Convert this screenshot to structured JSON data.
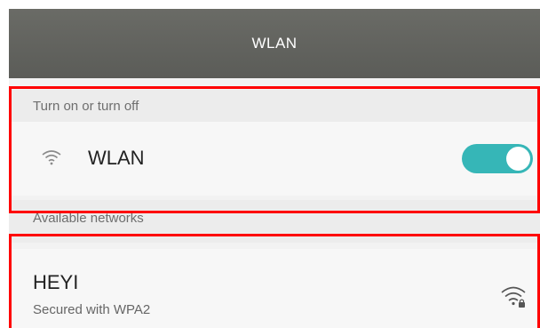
{
  "header": {
    "title": "WLAN"
  },
  "toggle_section": {
    "header": "Turn on or turn off"
  },
  "wlan_row": {
    "label": "WLAN",
    "enabled": true
  },
  "networks_section": {
    "header": "Available networks"
  },
  "networks": [
    {
      "name": "HEYI",
      "security": "Secured with WPA2",
      "icon": "wifi-lock-icon"
    }
  ],
  "colors": {
    "titlebar": "#5f605c",
    "toggle_on": "#36b6b7",
    "highlight": "#ff0000"
  }
}
